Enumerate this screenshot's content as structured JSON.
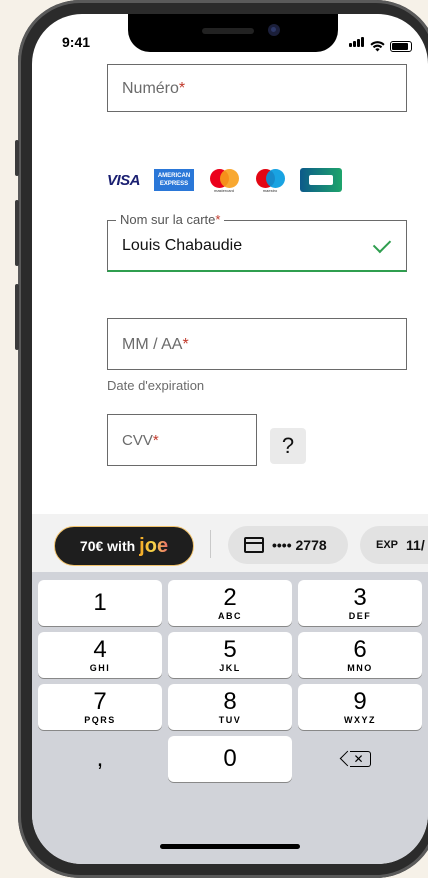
{
  "status": {
    "time": "9:41"
  },
  "form": {
    "number_placeholder": "Numéro",
    "required_mark": "*",
    "card_brands": [
      "VISA",
      "AMERICAN EXPRESS",
      "mastercard",
      "maestro",
      "CB"
    ],
    "name_label": "Nom sur la carte",
    "name_value": "Louis Chabaudie",
    "expiry_placeholder": "MM / AA",
    "expiry_hint": "Date d'expiration",
    "cvv_placeholder": "CVV",
    "cvv_help": "?"
  },
  "accessory": {
    "joe_prefix": "70€ with",
    "joe_brand": "joe",
    "card_label": "•••• 2778",
    "exp_prefix": "EXP",
    "exp_value": "11/"
  },
  "keyboard": {
    "keys": [
      {
        "n": "1",
        "l": ""
      },
      {
        "n": "2",
        "l": "ABC"
      },
      {
        "n": "3",
        "l": "DEF"
      },
      {
        "n": "4",
        "l": "GHI"
      },
      {
        "n": "5",
        "l": "JKL"
      },
      {
        "n": "6",
        "l": "MNO"
      },
      {
        "n": "7",
        "l": "PQRS"
      },
      {
        "n": "8",
        "l": "TUV"
      },
      {
        "n": "9",
        "l": "WXYZ"
      },
      {
        "n": ",",
        "l": ""
      },
      {
        "n": "0",
        "l": ""
      }
    ]
  },
  "colors": {
    "success": "#2f9e4f",
    "required": "#c0392b",
    "accent_joe": "#f4a623"
  }
}
